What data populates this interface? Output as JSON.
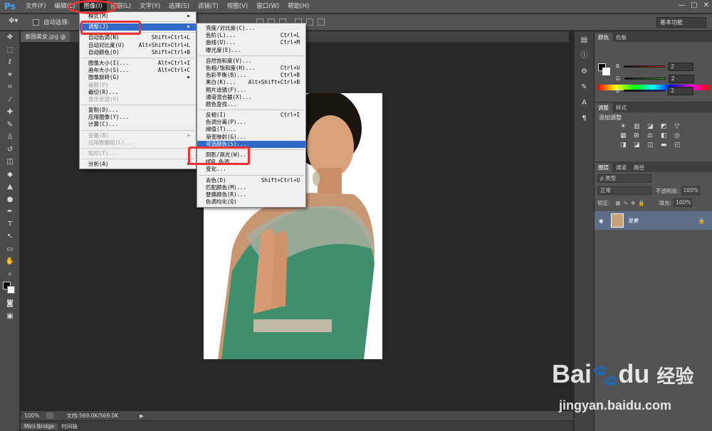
{
  "app": {
    "logo": "Ps"
  },
  "menubar": [
    "文件(F)",
    "编辑(E)",
    "图像(I)",
    "图层(L)",
    "文字(Y)",
    "选择(S)",
    "滤镜(T)",
    "视图(V)",
    "窗口(W)",
    "帮助(H)"
  ],
  "window_controls": {
    "minimize": "—",
    "maximize": "□",
    "close": "✕"
  },
  "options": {
    "auto_select": "自动选择:",
    "workspace": "基本功能"
  },
  "document": {
    "tab": "泰国美女.jpg @"
  },
  "status": {
    "zoom": "100%",
    "doc": "文档:569.0K/569.0K"
  },
  "bottom_tabs": [
    "Mini Bridge",
    "时间轴"
  ],
  "image_menu": [
    {
      "label": "模式(M)",
      "shortcut": "",
      "submenu": true
    },
    {
      "sep": true
    },
    {
      "label": "调整(J)",
      "shortcut": "",
      "submenu": true,
      "highlight": true
    },
    {
      "sep": true
    },
    {
      "label": "自动色调(N)",
      "shortcut": "Shift+Ctrl+L"
    },
    {
      "label": "自动对比度(U)",
      "shortcut": "Alt+Shift+Ctrl+L"
    },
    {
      "label": "自动颜色(O)",
      "shortcut": "Shift+Ctrl+B"
    },
    {
      "sep": true
    },
    {
      "label": "图像大小(I)...",
      "shortcut": "Alt+Ctrl+I"
    },
    {
      "label": "画布大小(S)...",
      "shortcut": "Alt+Ctrl+C"
    },
    {
      "label": "图像旋转(G)",
      "shortcut": "",
      "submenu": true
    },
    {
      "label": "裁剪(P)",
      "shortcut": "",
      "disabled": true
    },
    {
      "label": "裁切(R)...",
      "shortcut": ""
    },
    {
      "label": "显示全部(V)",
      "shortcut": "",
      "disabled": true
    },
    {
      "sep": true
    },
    {
      "label": "复制(D)...",
      "shortcut": ""
    },
    {
      "label": "应用图像(Y)...",
      "shortcut": ""
    },
    {
      "label": "计算(C)...",
      "shortcut": ""
    },
    {
      "sep": true
    },
    {
      "label": "变量(B)",
      "shortcut": "",
      "disabled": true,
      "submenu": true
    },
    {
      "label": "应用数据组(L)...",
      "shortcut": "",
      "disabled": true
    },
    {
      "sep": true
    },
    {
      "label": "陷印(T)...",
      "shortcut": "",
      "disabled": true
    },
    {
      "sep": true
    },
    {
      "label": "分析(A)",
      "shortcut": "",
      "submenu": true
    }
  ],
  "adjust_menu": [
    {
      "label": "亮度/对比度(C)...",
      "shortcut": ""
    },
    {
      "label": "色阶(L)...",
      "shortcut": "Ctrl+L"
    },
    {
      "label": "曲线(U)...",
      "shortcut": "Ctrl+M"
    },
    {
      "label": "曝光度(E)...",
      "shortcut": ""
    },
    {
      "sep": true
    },
    {
      "label": "自然饱和度(V)...",
      "shortcut": ""
    },
    {
      "label": "色相/饱和度(H)...",
      "shortcut": "Ctrl+U"
    },
    {
      "label": "色彩平衡(B)...",
      "shortcut": "Ctrl+B"
    },
    {
      "label": "黑白(K)...",
      "shortcut": "Alt+Shift+Ctrl+B"
    },
    {
      "label": "照片滤镜(F)...",
      "shortcut": ""
    },
    {
      "label": "通道混合器(X)...",
      "shortcut": ""
    },
    {
      "label": "颜色查找...",
      "shortcut": ""
    },
    {
      "sep": true
    },
    {
      "label": "反相(I)",
      "shortcut": "Ctrl+I"
    },
    {
      "label": "色调分离(P)...",
      "shortcut": ""
    },
    {
      "label": "阈值(T)...",
      "shortcut": ""
    },
    {
      "label": "渐变映射(G)...",
      "shortcut": ""
    },
    {
      "label": "可选颜色(S)...",
      "shortcut": "",
      "highlight": true
    },
    {
      "sep": true
    },
    {
      "label": "阴影/高光(W)...",
      "shortcut": ""
    },
    {
      "label": "HDR 色调...",
      "shortcut": ""
    },
    {
      "label": "变化...",
      "shortcut": ""
    },
    {
      "sep": true
    },
    {
      "label": "去色(D)",
      "shortcut": "Shift+Ctrl+U"
    },
    {
      "label": "匹配颜色(M)...",
      "shortcut": ""
    },
    {
      "label": "替换颜色(R)...",
      "shortcut": ""
    },
    {
      "label": "色调均化(Q)",
      "shortcut": ""
    }
  ],
  "panels": {
    "color_tabs": [
      "颜色",
      "色板"
    ],
    "rgb": [
      {
        "ch": "R",
        "val": "2",
        "color": "#d22"
      },
      {
        "ch": "G",
        "val": "2",
        "color": "#2a2"
      },
      {
        "ch": "B",
        "val": "2",
        "color": "#22d"
      }
    ],
    "adjust_tabs": [
      "调整",
      "样式"
    ],
    "adjust_title": "添加调整",
    "layer_tabs": [
      "图层",
      "通道",
      "路径"
    ],
    "kind": "ρ 类型",
    "blend": "正常",
    "opacity_label": "不透明度:",
    "opacity": "100%",
    "lock_label": "锁定:",
    "fill_label": "填充:",
    "fill": "100%",
    "layer_name": "背景"
  },
  "watermark": {
    "brand": "Bai",
    "brand2": "du",
    "cn": "经验",
    "url": "jingyan.baidu.com"
  }
}
